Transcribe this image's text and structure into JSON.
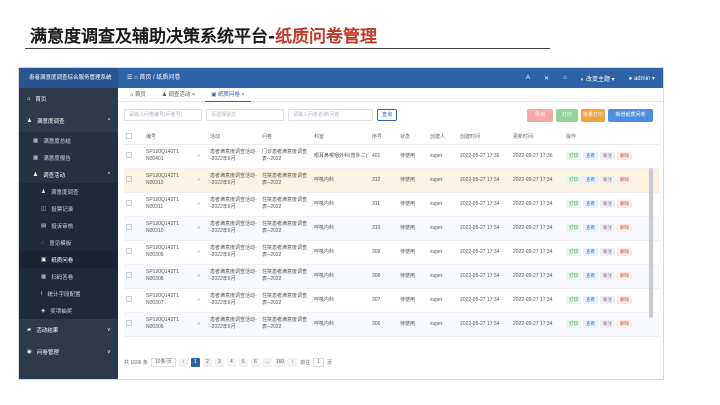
{
  "slide": {
    "title_black": "满意度调查及辅助决策系统平台-",
    "title_red": "纸质问卷管理"
  },
  "topbar": {
    "brand": "患者满意度调查综合服务管理系统",
    "crumb_home": "首页",
    "crumb_sep": "/",
    "crumb_page": "纸质问卷",
    "theme": "改变主题",
    "user": "admin"
  },
  "sidebar": {
    "home": "首页",
    "survey": "满意度调查",
    "survey_items": [
      "满意度总结",
      "满意度报告"
    ],
    "activity": "调查活动",
    "activity_items": [
      "满意度调查",
      "投票记录",
      "投诉审核",
      "意见模板",
      "纸质问卷",
      "扫码答卷",
      "统计字段配置",
      "奖项抽奖"
    ],
    "results": "活动结果",
    "questionnaire": "问卷管理"
  },
  "tabs": [
    "首页",
    "调查活动",
    "纸质问卷"
  ],
  "filters": {
    "code": "请输入问卷编号(问卷号)",
    "status": "请选择状态",
    "keyword": "请输入问卷名称/问卷",
    "search": "查询"
  },
  "actions": [
    {
      "label": "导出",
      "color": "#f7a7a7"
    },
    {
      "label": "打印",
      "color": "#8fd49a"
    },
    {
      "label": "批量打印",
      "color": "#f0a23c"
    },
    {
      "label": "新增纸质问卷",
      "color": "#4c8fe0"
    }
  ],
  "columns": [
    "",
    "编号",
    "",
    "活动",
    "问卷",
    "科室",
    "序号",
    "状态",
    "创建人",
    "创建时间",
    "更新时间",
    "操作"
  ],
  "rows": [
    {
      "code": "SP120Q140T1 N00401",
      "activity": "患者满意度调查活动--2022年6月",
      "survey": "门诊患者满意度调查表--2022",
      "dept": "眼耳鼻喉咽外科(普外二)",
      "seq": "401",
      "status": "待使用",
      "creator": "super",
      "created": "2022-05-27 17:36",
      "updated": "2022-05-27 17:36"
    },
    {
      "code": "SP120Q142T1 N00312",
      "activity": "患者满意度调查活动--2022年6月",
      "survey": "住院患者满意度调查表--2022",
      "dept": "呼吸内科",
      "seq": "312",
      "status": "待使用",
      "creator": "super",
      "created": "2022-05-27 17:34",
      "updated": "2022-05-27 17:34"
    },
    {
      "code": "SP120Q142T1 N00311",
      "activity": "患者满意度调查活动--2022年6月",
      "survey": "住院患者满意度调查表--2022",
      "dept": "呼吸内科",
      "seq": "311",
      "status": "待使用",
      "creator": "super",
      "created": "2022-05-27 17:34",
      "updated": "2022-05-27 17:34"
    },
    {
      "code": "SP120Q142T1 N00310",
      "activity": "患者满意度调查活动--2022年6月",
      "survey": "住院患者满意度调查表--2022",
      "dept": "呼吸内科",
      "seq": "310",
      "status": "待使用",
      "creator": "super",
      "created": "2022-05-27 17:34",
      "updated": "2022-05-27 17:34"
    },
    {
      "code": "SP120Q142T1 N00309",
      "activity": "患者满意度调查活动--2022年6月",
      "survey": "住院患者满意度调查表--2022",
      "dept": "呼吸内科",
      "seq": "309",
      "status": "待使用",
      "creator": "super",
      "created": "2022-05-27 17:34",
      "updated": "2022-05-27 17:34"
    },
    {
      "code": "SP120Q142T1 N00308",
      "activity": "患者满意度调查活动--2022年6月",
      "survey": "住院患者满意度调查表--2022",
      "dept": "呼吸内科",
      "seq": "308",
      "status": "待使用",
      "creator": "super",
      "created": "2022-05-27 17:34",
      "updated": "2022-05-27 17:34"
    },
    {
      "code": "SP120Q142T1 N00307",
      "activity": "患者满意度调查活动--2022年6月",
      "survey": "住院患者满意度调查表--2022",
      "dept": "呼吸内科",
      "seq": "307",
      "status": "待使用",
      "creator": "super",
      "created": "2022-05-27 17:34",
      "updated": "2022-05-27 17:34"
    },
    {
      "code": "SP120Q142T1 N00306",
      "activity": "患者满意度调查活动--2022年6月",
      "survey": "住院患者满意度调查表--2022",
      "dept": "呼吸内科",
      "seq": "306",
      "status": "待使用",
      "creator": "super",
      "created": "2022-05-27 17:34",
      "updated": "2022-05-27 17:34"
    }
  ],
  "row_ops": [
    "打印",
    "查看",
    "备注",
    "删除"
  ],
  "pager": {
    "total": "共 1606 条",
    "size": "10条/页",
    "pages": [
      "1",
      "2",
      "3",
      "4",
      "5",
      "6",
      "...",
      "160"
    ],
    "goto": "前往",
    "goto_val": "1",
    "page_unit": "页"
  }
}
